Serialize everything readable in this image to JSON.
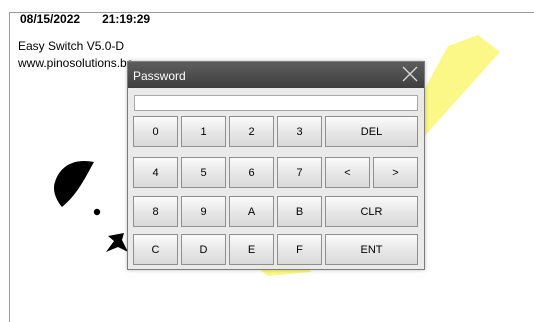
{
  "app": {
    "date": "08/15/2022",
    "time": "21:19:29",
    "version": "Easy Switch V5.0-D",
    "website": "www.pinosolutions.be"
  },
  "dialog": {
    "title": "Password",
    "password_value": "",
    "keys": [
      {
        "label": "0"
      },
      {
        "label": "1"
      },
      {
        "label": "2"
      },
      {
        "label": "3"
      },
      {
        "label": "DEL"
      },
      {
        "label": "4"
      },
      {
        "label": "5"
      },
      {
        "label": "6"
      },
      {
        "label": "7"
      },
      {
        "label": "<"
      },
      {
        "label": ">"
      },
      {
        "label": "8"
      },
      {
        "label": "9"
      },
      {
        "label": "A"
      },
      {
        "label": "B"
      },
      {
        "label": "CLR"
      },
      {
        "label": "C"
      },
      {
        "label": "D"
      },
      {
        "label": "E"
      },
      {
        "label": "F"
      },
      {
        "label": "ENT"
      }
    ]
  },
  "colors": {
    "accent_yellow": "#fbf77a",
    "titlebar": "#4a4a4a"
  }
}
